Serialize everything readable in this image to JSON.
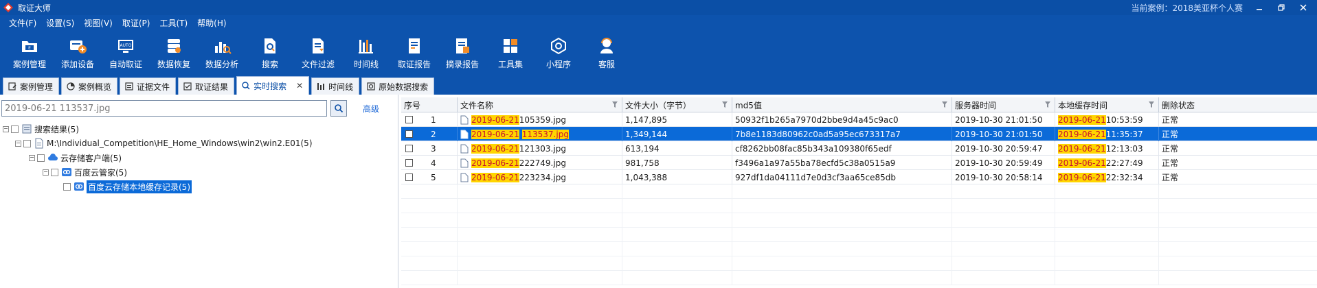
{
  "window": {
    "title": "取证大师",
    "case_label": "当前案例：",
    "case_name": "2018美亚杯个人赛"
  },
  "menu": [
    "文件(F)",
    "设置(S)",
    "视图(V)",
    "取证(P)",
    "工具(T)",
    "帮助(H)"
  ],
  "toolbar": [
    {
      "label": "案例管理",
      "icon": "case-folder-icon"
    },
    {
      "label": "添加设备",
      "icon": "add-device-icon"
    },
    {
      "label": "自动取证",
      "icon": "auto-monitor-icon"
    },
    {
      "label": "数据恢复",
      "icon": "data-recovery-icon"
    },
    {
      "label": "数据分析",
      "icon": "data-analysis-icon"
    },
    {
      "label": "搜索",
      "icon": "search-doc-icon"
    },
    {
      "label": "文件过滤",
      "icon": "file-filter-icon"
    },
    {
      "label": "时间线",
      "icon": "timeline-icon"
    },
    {
      "label": "取证报告",
      "icon": "report-icon"
    },
    {
      "label": "摘录报告",
      "icon": "excerpt-report-icon"
    },
    {
      "label": "工具集",
      "icon": "toolkit-icon"
    },
    {
      "label": "小程序",
      "icon": "mini-program-icon"
    },
    {
      "label": "客服",
      "icon": "customer-service-icon"
    }
  ],
  "tabs": [
    {
      "label": "案例管理",
      "icon": "case-tab-icon",
      "active": false
    },
    {
      "label": "案例概览",
      "icon": "overview-tab-icon",
      "active": false
    },
    {
      "label": "证据文件",
      "icon": "evidence-tab-icon",
      "active": false
    },
    {
      "label": "取证结果",
      "icon": "result-tab-icon",
      "active": false
    },
    {
      "label": "实时搜索",
      "icon": "realtime-search-tab-icon",
      "active": true,
      "closable": true
    },
    {
      "label": "时间线",
      "icon": "timeline-tab-icon",
      "active": false
    },
    {
      "label": "原始数据搜索",
      "icon": "raw-search-tab-icon",
      "active": false
    }
  ],
  "search": {
    "value": "2019-06-21 113537.jpg",
    "advanced_label": "高级"
  },
  "tree": [
    {
      "label": "搜索结果(5)",
      "level": 0,
      "icon": "search-results-icon",
      "selected": false
    },
    {
      "label": "M:\\Individual_Competition\\HE_Home_Windows\\win2\\win2.E01(5)",
      "level": 1,
      "icon": "disk-image-icon",
      "selected": false
    },
    {
      "label": "云存储客户端(5)",
      "level": 2,
      "icon": "cloud-client-icon",
      "selected": false
    },
    {
      "label": "百度云管家(5)",
      "level": 3,
      "icon": "baidu-cloud-icon",
      "selected": false
    },
    {
      "label": "百度云存储本地缓存记录(5)",
      "level": 4,
      "icon": "baidu-cache-icon",
      "selected": true
    }
  ],
  "grid": {
    "columns": [
      "序号",
      "文件名称",
      "文件大小（字节）",
      "md5值",
      "服务器时间",
      "本地缓存时间",
      "删除状态"
    ],
    "highlight_term": "2019-06-21",
    "rows": [
      {
        "no": "1",
        "name_date": "2019-06-21",
        "name_rest": " 105359.jpg",
        "size": "1,147,895",
        "md5": "50932f1b265a7970d2bbe9d4a45c9ac0",
        "server_time": "2019-10-30 21:01:50",
        "cache_date": "2019-06-21",
        "cache_time": " 10:53:59",
        "status": "正常",
        "selected": false
      },
      {
        "no": "2",
        "name_date": "2019-06-21",
        "name_rest": "113537.jpg",
        "size": "1,349,144",
        "md5": "7b8e1183d80962c0ad5a95ec673317a7",
        "server_time": "2019-10-30 21:01:50",
        "cache_date": "2019-06-21",
        "cache_time": " 11:35:37",
        "status": "正常",
        "selected": true
      },
      {
        "no": "3",
        "name_date": "2019-06-21",
        "name_rest": " 121303.jpg",
        "size": "613,194",
        "md5": "cf8262bb08fac85b343a109380f65edf",
        "server_time": "2019-10-30 20:59:47",
        "cache_date": "2019-06-21",
        "cache_time": " 12:13:03",
        "status": "正常",
        "selected": false
      },
      {
        "no": "4",
        "name_date": "2019-06-21",
        "name_rest": " 222749.jpg",
        "size": "981,758",
        "md5": "f3496a1a97a55ba78ecfd5c38a0515a9",
        "server_time": "2019-10-30 20:59:49",
        "cache_date": "2019-06-21",
        "cache_time": " 22:27:49",
        "status": "正常",
        "selected": false
      },
      {
        "no": "5",
        "name_date": "2019-06-21",
        "name_rest": " 223234.jpg",
        "size": "1,043,388",
        "md5": "927df1da04111d7e0d3cf3aa65ce85db",
        "server_time": "2019-10-30 20:58:14",
        "cache_date": "2019-06-21",
        "cache_time": " 22:32:34",
        "status": "正常",
        "selected": false
      }
    ]
  },
  "colors": {
    "title_bar": "#0b4fa6",
    "toolbar": "#0d53ad",
    "selection": "#0b6ad8",
    "highlight_bg": "#ffd500",
    "highlight_text": "#c8102e"
  }
}
